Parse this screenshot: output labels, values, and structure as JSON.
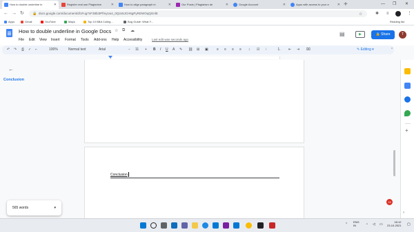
{
  "browser": {
    "tabs": [
      {
        "title": "How to double underline in",
        "active": true,
        "color": "#4285f4"
      },
      {
        "title": "Register real use Plagiarism",
        "active": false,
        "color": "#e8453c"
      },
      {
        "title": "How to align paragraph in",
        "active": false,
        "color": "#4285f4"
      },
      {
        "title": "Our Posts | Plagiarism de",
        "active": false,
        "color": "#9c27b0"
      },
      {
        "title": "Google Account",
        "active": false,
        "color": "#4285f4"
      },
      {
        "title": "Apps with access to your a",
        "active": false,
        "color": "#4285f4"
      }
    ],
    "new_tab": "+",
    "url": "docs.google.com/document/d/1Fug7nF38bI3Pfmy1w4_0Q2x5JCH6gPyRDWOqQGnlE",
    "reading_list": "Reading list",
    "bookmarks": [
      {
        "label": "Apps",
        "color": "#4285f4"
      },
      {
        "label": "Gmail",
        "color": "#ea4335"
      },
      {
        "label": "YouTube",
        "color": "#ff0000"
      },
      {
        "label": "Maps",
        "color": "#34a853"
      },
      {
        "label": "Top 10 BBA Colleg...",
        "color": "#f4b400"
      },
      {
        "label": "Bug Guide: What Y...",
        "color": "#5f6368"
      }
    ]
  },
  "docs": {
    "title": "How to double underline in Google Docs",
    "menus": [
      "File",
      "Edit",
      "View",
      "Insert",
      "Format",
      "Tools",
      "Add-ons",
      "Help",
      "Accessibility"
    ],
    "last_edit": "Last edit was seconds ago",
    "share_label": "Share",
    "avatar_letter": "T",
    "toolbar": {
      "zoom": "100%",
      "style": "Normal text",
      "font": "Arial",
      "font_size": "11",
      "mode": "Editing"
    },
    "outline": {
      "items": [
        "Conclusion"
      ]
    },
    "page_text": "Conclusion",
    "word_count": "565 words",
    "notification_count": "15"
  },
  "taskbar": {
    "lang": "ENG",
    "region": "IN",
    "time": "18:12",
    "date": "23-10-2021"
  }
}
